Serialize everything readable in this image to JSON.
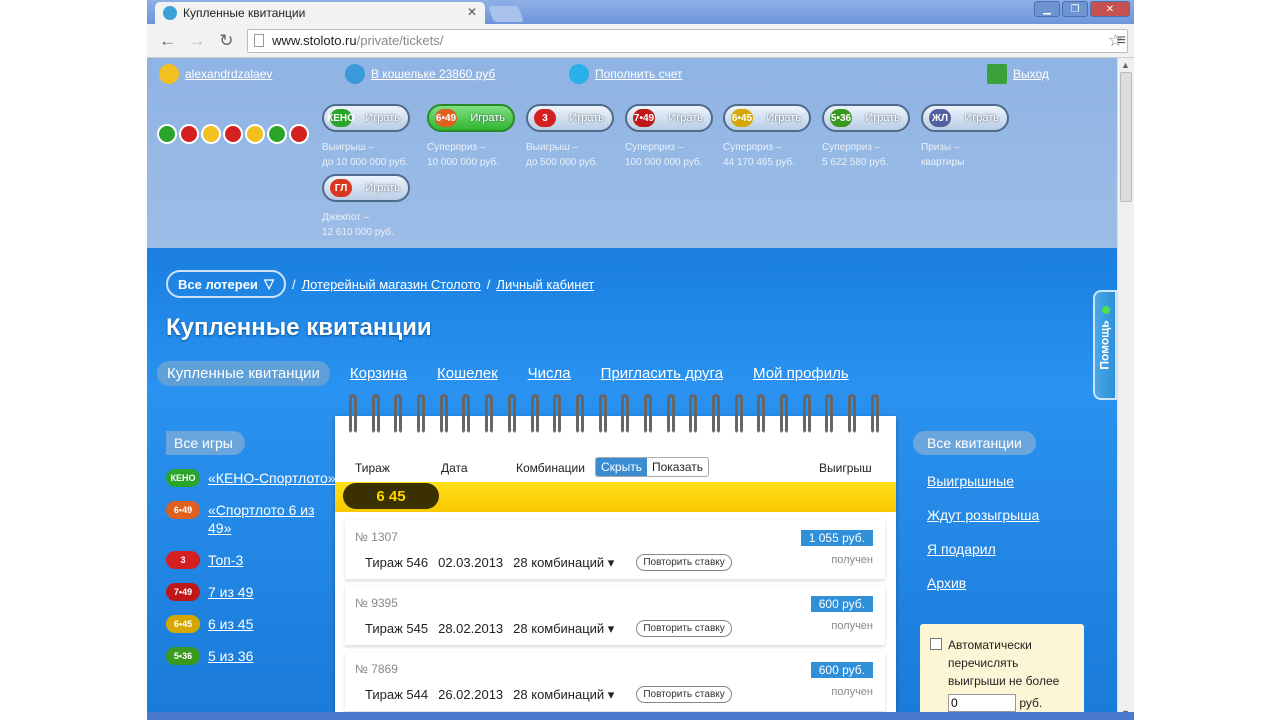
{
  "browser": {
    "tab_title": "Купленные квитанции",
    "url_domain": "www.stoloto.ru",
    "url_path": "/private/tickets/"
  },
  "topbar": {
    "username": "alexandrdzalaev",
    "wallet": "В кошельке 23860 руб",
    "topup": "Пополнить счет",
    "logout": "Выход"
  },
  "games": [
    {
      "ball": "КЕНО",
      "color": "#2aa52a",
      "play": "Играть",
      "desc1": "Выигрыш –",
      "desc2": "до 10 000 000 руб."
    },
    {
      "ball": "6•49",
      "color": "#e06020",
      "play": "Играть",
      "desc1": "Суперприз –",
      "desc2": "10 000 000 руб.",
      "active": true
    },
    {
      "ball": "3",
      "color": "#d42020",
      "play": "Играть",
      "desc1": "Выигрыш –",
      "desc2": "до 500 000 руб."
    },
    {
      "ball": "7•49",
      "color": "#c01818",
      "play": "Играть",
      "desc1": "Суперприз –",
      "desc2": "100 000 000 руб."
    },
    {
      "ball": "6•45",
      "color": "#d4a800",
      "play": "Играть",
      "desc1": "Суперприз –",
      "desc2": "44 170 465 руб."
    },
    {
      "ball": "5•36",
      "color": "#3a9a20",
      "play": "Играть",
      "desc1": "Суперприз –",
      "desc2": "5 622 580 руб."
    },
    {
      "ball": "ЖЛ",
      "color": "#5060a0",
      "play": "Играть",
      "desc1": "Призы –",
      "desc2": "квартиры"
    },
    {
      "ball": "ГЛ",
      "color": "#d83820",
      "play": "Играть",
      "desc1": "Джекпот –",
      "desc2": "12 610 000 руб."
    }
  ],
  "breadcrumb": {
    "all_lotteries": "Все лотереи",
    "shop": "Лотерейный магазин Столото",
    "cabinet": "Личный кабинет"
  },
  "page_title": "Купленные квитанции",
  "subnav": [
    "Купленные квитанции",
    "Корзина",
    "Кошелек",
    "Числа",
    "Пригласить друга",
    "Мой профиль"
  ],
  "left_filter": {
    "all": "Все игры",
    "items": [
      {
        "ball": "КЕНО",
        "color": "#2aa52a",
        "label": "«КЕНО-Спортлото»"
      },
      {
        "ball": "6•49",
        "color": "#e06020",
        "label": "«Спортлото 6 из 49»"
      },
      {
        "ball": "3",
        "color": "#d42020",
        "label": "Топ-3"
      },
      {
        "ball": "7•49",
        "color": "#c01818",
        "label": "7 из 49"
      },
      {
        "ball": "6•45",
        "color": "#d4a800",
        "label": "6 из 45"
      },
      {
        "ball": "5•36",
        "color": "#3a9a20",
        "label": "5 из 36"
      }
    ]
  },
  "right_filter": {
    "all": "Все квитанции",
    "items": [
      "Выигрышные",
      "Ждут розыгрыша",
      "Я подарил",
      "Архив"
    ]
  },
  "auto_box": {
    "text": "Автоматически перечислять выигрыши не более",
    "value": "0",
    "unit": "руб."
  },
  "help": "Помощь",
  "table": {
    "headers": {
      "draw": "Тираж",
      "date": "Дата",
      "combos": "Комбинации",
      "win": "Выигрыш"
    },
    "toggle_hide": "Скрыть",
    "toggle_show": "Показать",
    "lottery_band": "6 45",
    "tickets": [
      {
        "no": "№ 1307",
        "draw": "Тираж 546",
        "date": "02.03.2013",
        "combos": "28 комбинаций ▾",
        "repeat": "Повторить ставку",
        "win": "1 055 руб.",
        "status": "получен"
      },
      {
        "no": "№ 9395",
        "draw": "Тираж 545",
        "date": "28.02.2013",
        "combos": "28 комбинаций ▾",
        "repeat": "Повторить ставку",
        "win": "600 руб.",
        "status": "получен"
      },
      {
        "no": "№ 7869",
        "draw": "Тираж 544",
        "date": "26.02.2013",
        "combos": "28 комбинаций ▾",
        "repeat": "Повторить ставку",
        "win": "600 руб.",
        "status": "получен"
      }
    ]
  }
}
